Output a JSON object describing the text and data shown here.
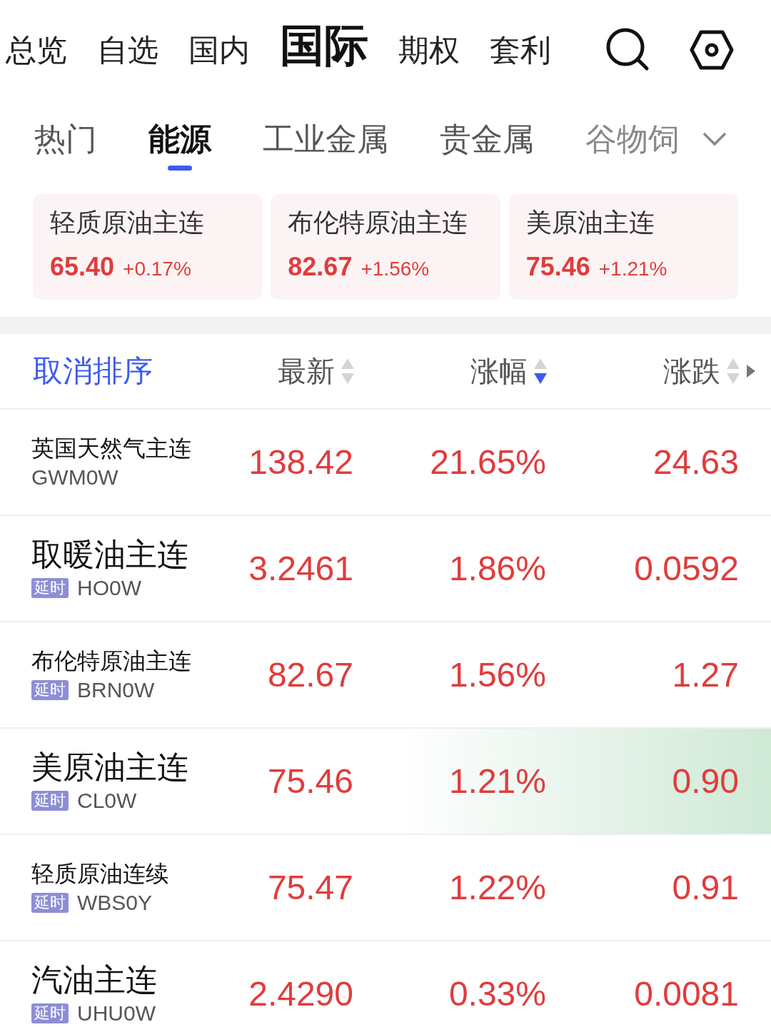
{
  "top_tabs": [
    {
      "label": "总览",
      "selected": false
    },
    {
      "label": "自选",
      "selected": false
    },
    {
      "label": "国内",
      "selected": false
    },
    {
      "label": "国际",
      "selected": true
    },
    {
      "label": "期权",
      "selected": false
    },
    {
      "label": "套利",
      "selected": false
    }
  ],
  "sub_tabs": [
    {
      "label": "热门",
      "selected": false
    },
    {
      "label": "能源",
      "selected": true
    },
    {
      "label": "工业金属",
      "selected": false
    },
    {
      "label": "贵金属",
      "selected": false
    },
    {
      "label": "谷物饲",
      "selected": false
    }
  ],
  "cards": [
    {
      "name": "轻质原油主连",
      "price": "65.40",
      "change": "+0.17%"
    },
    {
      "name": "布伦特原油主连",
      "price": "82.67",
      "change": "+1.56%"
    },
    {
      "name": "美原油主连",
      "price": "75.46",
      "change": "+1.21%"
    }
  ],
  "table": {
    "reset_sort": "取消排序",
    "columns": [
      {
        "label": "最新",
        "sorted": false
      },
      {
        "label": "涨幅",
        "sorted": true
      },
      {
        "label": "涨跌",
        "sorted": false
      }
    ],
    "rows": [
      {
        "name": "英国天然气主连",
        "code": "GWM0W",
        "price": "138.42",
        "change_pct": "21.65%",
        "change": "24.63",
        "highlighted": false
      },
      {
        "name": "取暖油主连",
        "tag": "延时",
        "code": "HO0W",
        "price": "3.2461",
        "change_pct": "1.86%",
        "change": "0.0592",
        "highlighted": false
      },
      {
        "name": "布伦特原油主连",
        "tag": "延时",
        "code": "BRN0W",
        "price": "82.67",
        "change_pct": "1.56%",
        "change": "1.27",
        "highlighted": false
      },
      {
        "name": "美原油主连",
        "tag": "延时",
        "code": "CL0W",
        "price": "75.46",
        "change_pct": "1.21%",
        "change": "0.90",
        "highlighted": true
      },
      {
        "name": "轻质原油连续",
        "tag": "延时",
        "code": "WBS0Y",
        "price": "75.47",
        "change_pct": "1.22%",
        "change": "0.91",
        "highlighted": false
      },
      {
        "name": "汽油主连",
        "tag": "延时",
        "code": "UHU0W",
        "price": "2.4290",
        "change_pct": "0.33%",
        "change": "0.0081",
        "highlighted": false
      }
    ]
  }
}
